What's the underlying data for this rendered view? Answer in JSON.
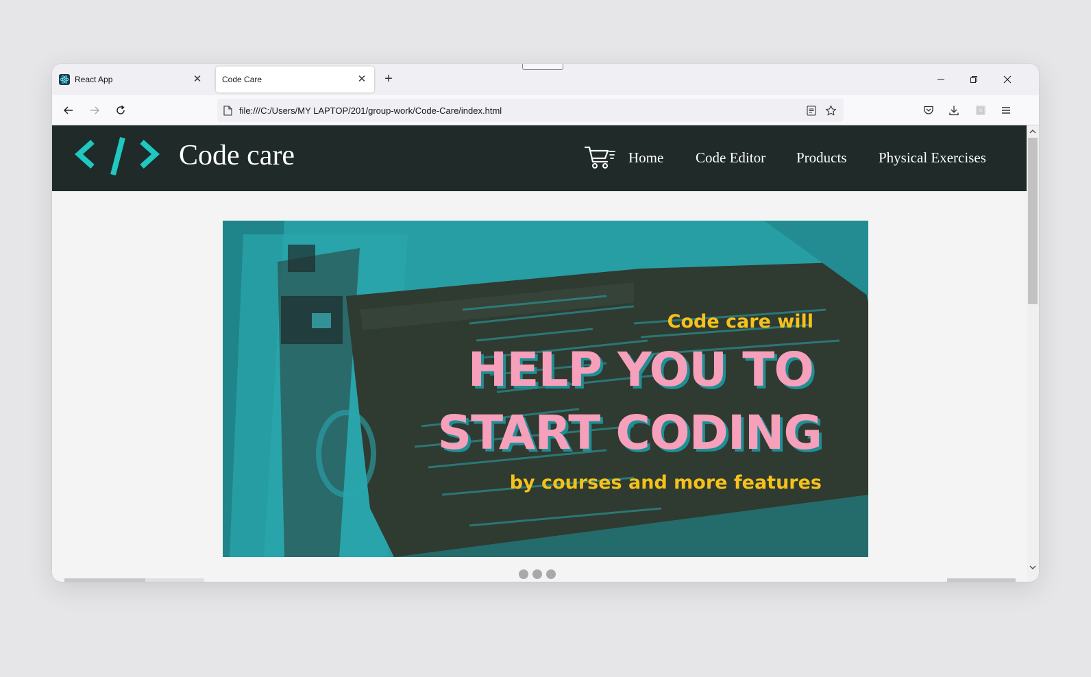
{
  "browser": {
    "tabs": [
      {
        "label": "React App",
        "favicon": "react-icon",
        "active": false
      },
      {
        "label": "Code Care",
        "favicon": "",
        "active": true
      }
    ],
    "new_tab_icon": "plus-icon",
    "url": "file:///C:/Users/MY LAPTOP/201/group-work/Code-Care/index.html",
    "window_controls": [
      "minimize-icon",
      "restore-icon",
      "close-icon"
    ],
    "nav_icons": [
      "back-arrow-icon",
      "forward-arrow-icon",
      "reload-icon"
    ],
    "toolbar_icons": [
      "reader-view-icon",
      "bookmark-star-icon",
      "pocket-icon",
      "download-icon",
      "extension-icon",
      "menu-icon"
    ]
  },
  "site": {
    "logo_icon": "code-brackets-icon",
    "logo_color": "#1fc8c0",
    "header_bg": "#1f2a29",
    "brand": "Code care",
    "cart_icon": "shopping-cart-icon",
    "nav": [
      "Home",
      "Code Editor",
      "Products",
      "Physical Exercises"
    ]
  },
  "hero": {
    "line1": "Code care will",
    "line2": "HELP YOU TO",
    "line3": "START CODING",
    "line4": "by courses and more features",
    "accent_yellow": "#f5c21b",
    "accent_pink": "#f7a0bb",
    "slide_count": 3
  }
}
